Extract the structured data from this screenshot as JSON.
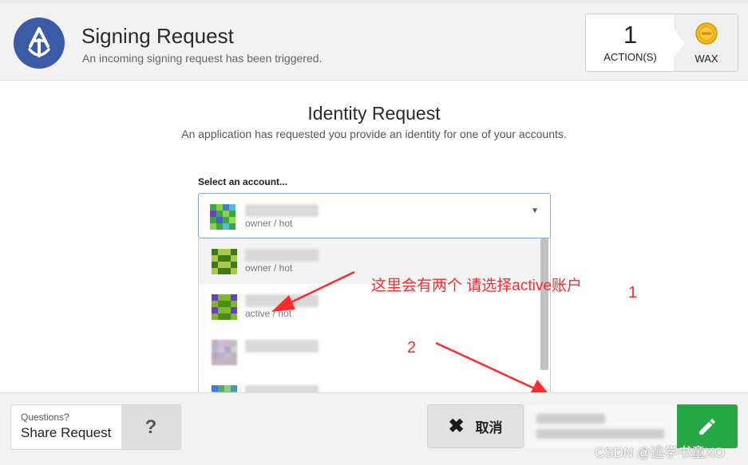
{
  "header": {
    "title": "Signing Request",
    "subtitle": "An incoming signing request has been triggered.",
    "action_count": "1",
    "action_label": "ACTION(S)",
    "chain_label": "WAX"
  },
  "identity": {
    "title": "Identity Request",
    "subtitle": "An application has requested you provide an identity for one of your accounts."
  },
  "account_select": {
    "label": "Select an account...",
    "selected": {
      "permission": "owner / hot"
    },
    "options": [
      {
        "permission": "owner / hot"
      },
      {
        "permission": "active / hot"
      },
      {
        "permission": ""
      },
      {
        "permission": ""
      }
    ]
  },
  "annotation": {
    "note": "这里会有两个  请选择active账户",
    "marker_1": "1",
    "marker_2": "2"
  },
  "footer": {
    "questions_small": "Questions?",
    "questions_big": "Share Request",
    "help_glyph": "?",
    "cancel_label": "取消"
  },
  "watermark": "CSDN @逃学书童XO",
  "icons": {
    "logo": "anchor-logo-icon",
    "chain": "wax-coin-icon",
    "help": "question-mark-icon",
    "cancel": "close-icon",
    "sign": "pencil-icon"
  },
  "colors": {
    "logo_bg": "#3b5ba7",
    "sign_button": "#26a845",
    "annotation": "#ff2a2a",
    "select_border": "#7ea6d8"
  }
}
